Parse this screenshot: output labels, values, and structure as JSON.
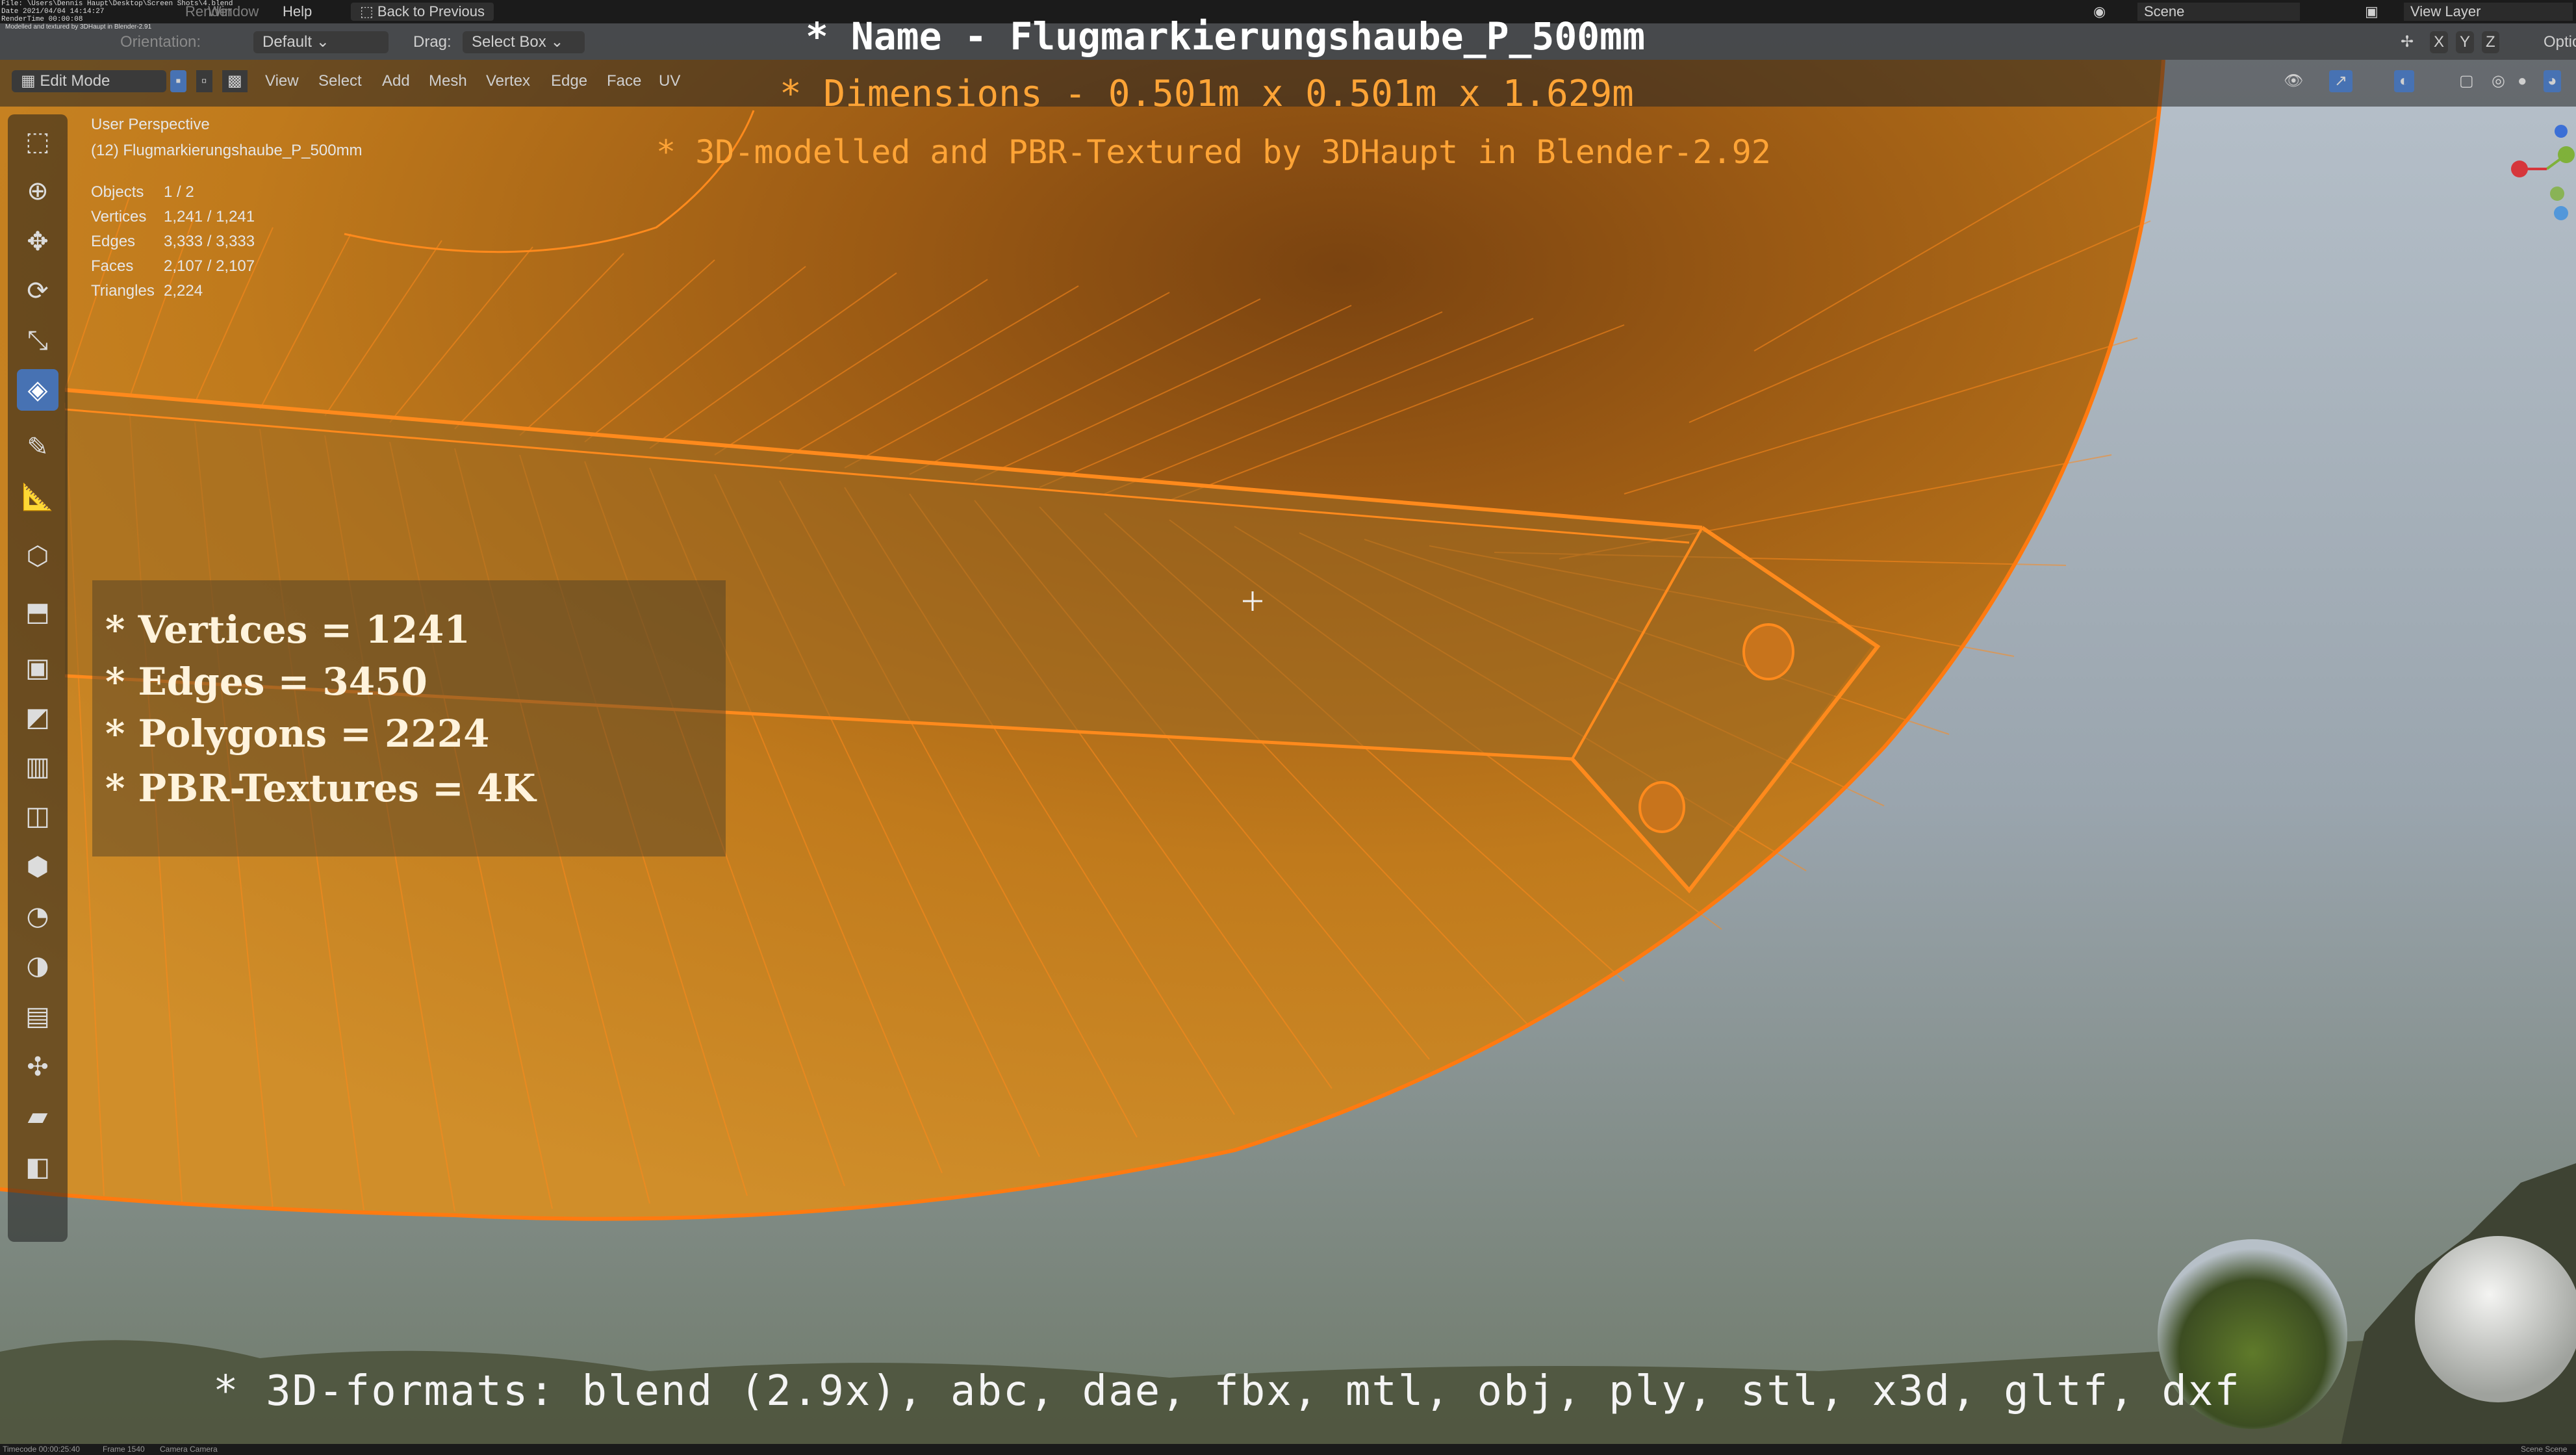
{
  "topbar": {
    "file_info": "File: \\Users\\Dennis Haupt\\Desktop\\Screen Shots\\4.blend",
    "render_info_1": "Date 2021/04/04 14:14:27",
    "render_info_2": "RenderTime 00:00:08",
    "render_info_3": "Modelled and textured by 3DHaupt in Blender-2.91",
    "menu_render": "Render",
    "menu_window": "Window",
    "menu_help": "Help",
    "back_to_previous": "Back to Previous",
    "scene_label": "Scene",
    "view_layer_label": "View Layer"
  },
  "header": {
    "orientation_label": "Orientation:",
    "orientation_value": "Default",
    "drag_label": "Drag:",
    "drag_value": "Select Box",
    "mode": "Edit Mode",
    "menus": [
      "View",
      "Select",
      "Add",
      "Mesh",
      "Vertex",
      "Edge",
      "Face",
      "UV"
    ],
    "axis_x": "X",
    "axis_y": "Y",
    "axis_z": "Z",
    "options_label": "Options"
  },
  "viewport_info": {
    "perspective": "User Perspective",
    "object_name": "(12) Flugmarkierungshaube_P_500mm",
    "stats": [
      {
        "label": "Objects",
        "value": "1 / 2"
      },
      {
        "label": "Vertices",
        "value": "1,241 / 1,241"
      },
      {
        "label": "Edges",
        "value": "3,333 / 3,333"
      },
      {
        "label": "Faces",
        "value": "2,107 / 2,107"
      },
      {
        "label": "Triangles",
        "value": "2,224"
      }
    ]
  },
  "overlay": {
    "name_line": "* Name - Flugmarkierungshaube_P_500mm",
    "dimensions_line": "* Dimensions -  0.501m x 0.501m x 1.629m",
    "credit_line": "* 3D-modelled and PBR-Textured by 3DHaupt in Blender-2.92",
    "stats_lines": [
      "* Vertices = 1241",
      "* Edges = 3450",
      "* Polygons = 2224",
      "* PBR-Textures = 4K"
    ],
    "formats_line": "* 3D-formats: blend (2.9x), abc, dae, fbx, mtl, obj, ply, stl, x3d, gltf, dxf"
  },
  "bottombar": {
    "timecode": "Timecode 00:00:25:40",
    "frame": "Frame 1540",
    "camera": "Camera Camera",
    "scene": "Scene Scene"
  },
  "colors": {
    "mesh_orange": "#d98a1a",
    "edge_orange": "#ff8a1c",
    "title_orange": "#ffa436",
    "active_tool_blue": "#4772b3",
    "sky": "#8e99a3"
  },
  "tools": [
    "select-box-icon",
    "cursor-icon",
    "move-icon",
    "rotate-icon",
    "scale-icon",
    "transform-icon",
    "annotate-icon",
    "measure-icon",
    "add-cube-icon",
    "extrude-icon",
    "inset-icon",
    "bevel-icon",
    "loop-cut-icon",
    "knife-icon",
    "poly-build-icon",
    "spin-icon",
    "smooth-icon",
    "edge-slide-icon",
    "shrink-fatten-icon",
    "shear-icon",
    "rip-region-icon"
  ]
}
